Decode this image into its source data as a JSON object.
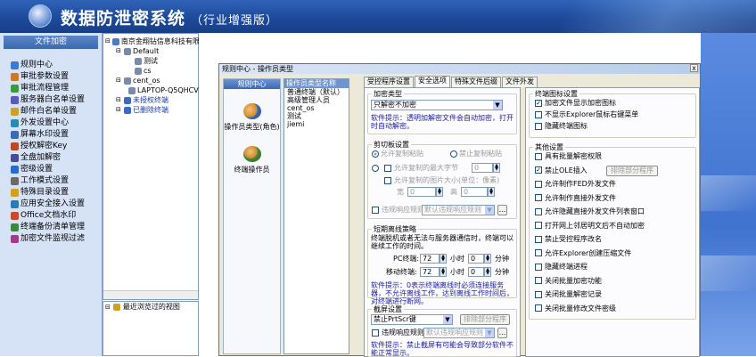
{
  "header": {
    "title": "数据防泄密系统",
    "subtitle": "（行业增强版）"
  },
  "sidebar": {
    "caption": "文件加密",
    "items": [
      {
        "label": "规则中心",
        "icon": "rules-icon",
        "color": "#3a7ad0"
      },
      {
        "label": "审批参数设置",
        "icon": "approval-params-icon",
        "color": "#c87b2a"
      },
      {
        "label": "审批流程管理",
        "icon": "approval-flow-icon",
        "color": "#3a9b3a"
      },
      {
        "label": "服务器白名单设置",
        "icon": "server-whitelist-icon",
        "color": "#5a5ab8"
      },
      {
        "label": "邮件白名单设置",
        "icon": "mail-whitelist-icon",
        "color": "#d0a020"
      },
      {
        "label": "外发设置中心",
        "icon": "outgoing-icon",
        "color": "#2a8ab0"
      },
      {
        "label": "屏幕水印设置",
        "icon": "watermark-icon",
        "color": "#3a6ab8"
      },
      {
        "label": "授权解密Key",
        "icon": "key-icon",
        "color": "#b84a2a"
      },
      {
        "label": "全盘加解密",
        "icon": "disk-encrypt-icon",
        "color": "#4a4a9a"
      },
      {
        "label": "密级设置",
        "icon": "secret-level-icon",
        "color": "#2a6ac8"
      },
      {
        "label": "工作模式设置",
        "icon": "work-mode-icon",
        "color": "#6a6a6a"
      },
      {
        "label": "特殊目录设置",
        "icon": "special-dir-icon",
        "color": "#d0a020"
      },
      {
        "label": "应用安全接入设置",
        "icon": "app-access-icon",
        "color": "#2a7ab8"
      },
      {
        "label": "Office文档水印",
        "icon": "office-watermark-icon",
        "color": "#c84a2a"
      },
      {
        "label": "终端备份清单管理",
        "icon": "backup-list-icon",
        "color": "#3a8a3a"
      },
      {
        "label": "加密文件监视过滤",
        "icon": "monitor-filter-icon",
        "color": "#a03a8a"
      }
    ]
  },
  "tree": {
    "nodes": [
      {
        "label": "南京金翔钻信息科技有限",
        "depth": 0
      },
      {
        "label": "Default",
        "depth": 1
      },
      {
        "label": "测试",
        "depth": 2
      },
      {
        "label": "cs",
        "depth": 2
      },
      {
        "label": "cent_os",
        "depth": 1
      },
      {
        "label": "LAPTOP-Q5QHCV2P",
        "depth": 2
      },
      {
        "label": "未授权终端",
        "depth": 1,
        "blue": true
      },
      {
        "label": "已删除终端",
        "depth": 1,
        "blue": true
      }
    ],
    "recent": "最近浏览过的视图"
  },
  "dialog": {
    "title": "规则中心 - 操作员类型",
    "close": "x",
    "nav_header": "规则中心",
    "nav_items": [
      "操作员类型(角色)",
      "终端操作员"
    ],
    "list_header": "操作员类型名称",
    "list_rows": [
      "普通终端（默认）",
      "高级管理人员",
      "cent_os",
      "测试",
      "jiemi"
    ],
    "tabs": [
      "受控程序设置",
      "安全选项",
      "特殊文件后缀",
      "文件外发"
    ],
    "active_tab": 1,
    "encrypt_type": {
      "label": "加密类型",
      "value": "只解密不加密",
      "note": "软件提示：透明加解密文件会自动加密，打开时自动解密。"
    },
    "clipboard": {
      "label": "剪切板设置",
      "radio_allow": "允许复制粘贴",
      "radio_forbid": "禁止复制粘贴",
      "max_text": "允许复制的最大字节",
      "max_text_val": "0",
      "max_image": "允许复制的图片大小(单位：像素)",
      "w_label": "宽",
      "w_val": "0",
      "h_label": "高",
      "h_val": "0",
      "violation": "违规响应规则",
      "violation_val": "默认违规响应规则",
      "more": "..."
    },
    "offline": {
      "label": "短期离线策略",
      "desc": "终端脱机或者无法与服务器通信时，终端可以继续工作的时间。",
      "pc_label": "PC终端:",
      "pc_hours": "72",
      "pc_mins": "0",
      "mobile_label": "移动终端:",
      "mobile_hours": "72",
      "mobile_mins": "0",
      "hour": "小时",
      "minute": "分钟",
      "note": "软件提示：0表示终端离线时必须连接服务器，不允许离线工作，达到离线工作时间后，对终端进行断网。"
    },
    "screenshot": {
      "label": "截屏设置",
      "value": "禁止PrtScr键",
      "exclude": "排除部分程序",
      "violation": "违规响应规则",
      "violation_val": "默认违规响应规则",
      "more": "...",
      "note": "软件提示：禁止截屏有可能会导致部分软件不能正常显示。"
    },
    "icon_group": {
      "label": "终端图标设置",
      "items": [
        {
          "label": "加密文件显示加密图标",
          "checked": true
        },
        {
          "label": "不显示Explorer鼠标右键菜单",
          "checked": false
        },
        {
          "label": "隐藏终端图标",
          "checked": false
        }
      ]
    },
    "other_group": {
      "label": "其他设置",
      "items": [
        {
          "label": "具有批量解密权限",
          "checked": false
        },
        {
          "label": "禁止OLE插入",
          "checked": true,
          "button": "排除部分程序"
        },
        {
          "label": "允许制作FED外发文件",
          "checked": false
        },
        {
          "label": "允许制作直接外发文件",
          "checked": false
        },
        {
          "label": "允许隐藏直接外发文件列表窗口",
          "checked": false
        },
        {
          "label": "打开网上邻居明文后不自动加密",
          "checked": false
        },
        {
          "label": "禁止受控程序改名",
          "checked": false
        },
        {
          "label": "允许Explorer创建压缩文件",
          "checked": false
        },
        {
          "label": "隐藏终端进程",
          "checked": false
        },
        {
          "label": "关闭批量加密功能",
          "checked": false
        },
        {
          "label": "关闭批量解密记录",
          "checked": false
        },
        {
          "label": "关闭批量修改文件密级",
          "checked": false
        }
      ]
    }
  }
}
